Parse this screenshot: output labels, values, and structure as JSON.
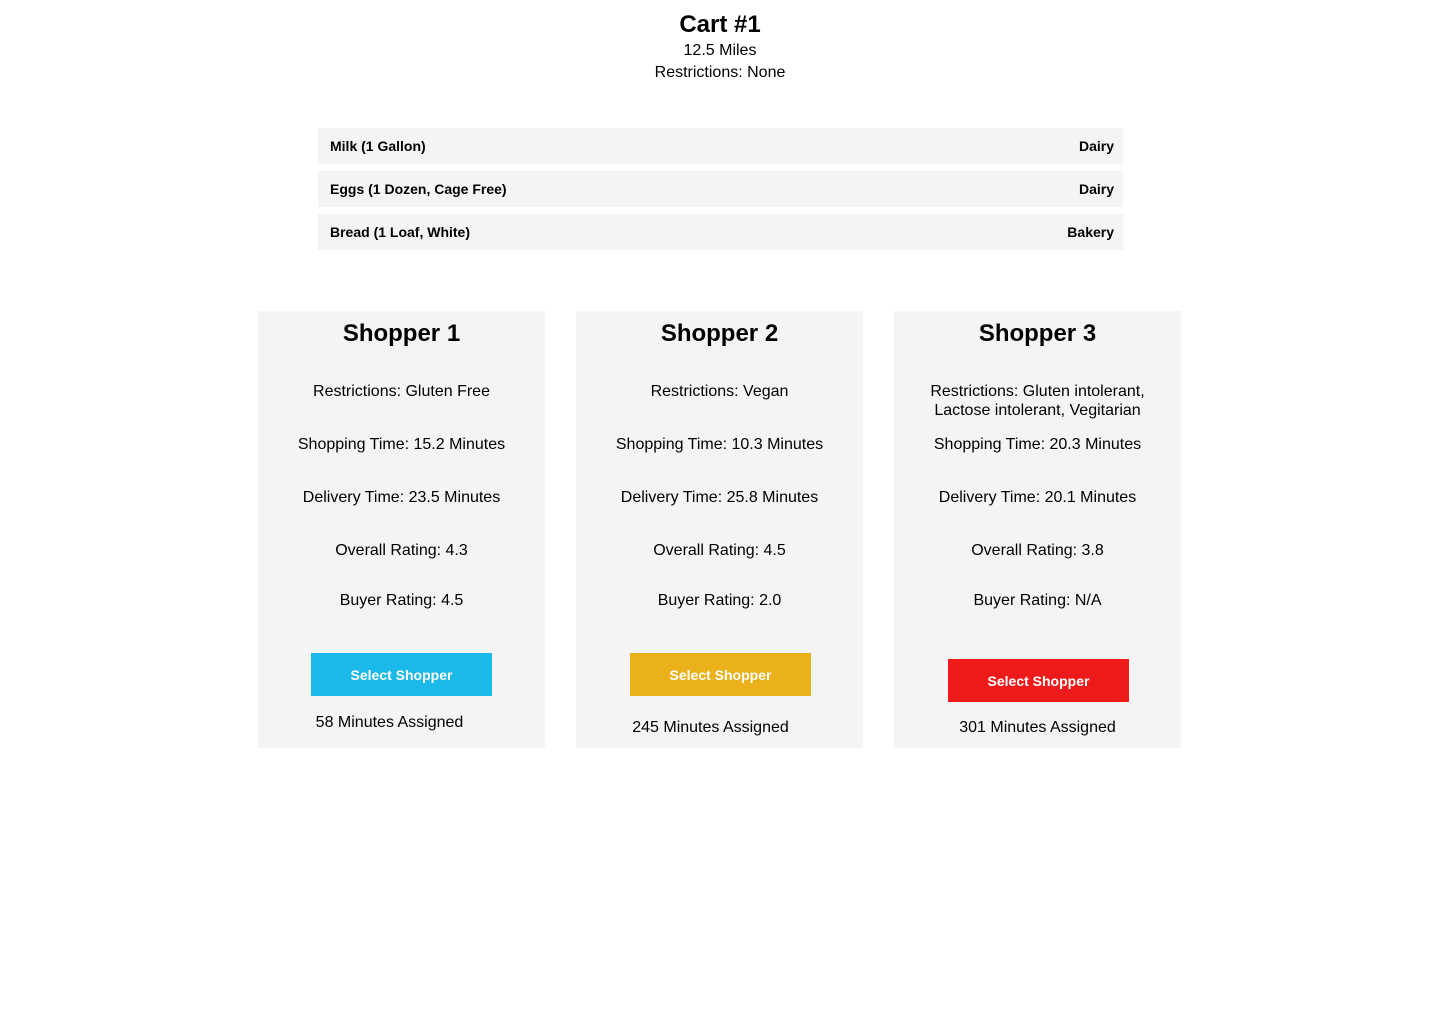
{
  "cart": {
    "title": "Cart #1",
    "distance": "12.5 Miles",
    "restrictions": "Restrictions: None"
  },
  "items": [
    {
      "name": "Milk (1 Gallon)",
      "category": "Dairy"
    },
    {
      "name": "Eggs (1 Dozen, Cage Free)",
      "category": "Dairy"
    },
    {
      "name": "Bread (1 Loaf, White)",
      "category": "Bakery"
    }
  ],
  "shoppers": [
    {
      "name": "Shopper 1",
      "restrictions": "Restrictions: Gluten Free",
      "shopping_time": "Shopping Time: 15.2 Minutes",
      "delivery_time": "Delivery Time: 23.5 Minutes",
      "overall_rating": "Overall Rating: 4.3",
      "buyer_rating": "Buyer Rating: 4.5",
      "button_label": "Select Shopper",
      "button_color": "#1bb8ea",
      "assigned": "58 Minutes Assigned"
    },
    {
      "name": "Shopper 2",
      "restrictions": "Restrictions: Vegan",
      "shopping_time": "Shopping Time: 10.3 Minutes",
      "delivery_time": "Delivery Time: 25.8 Minutes",
      "overall_rating": "Overall Rating: 4.5",
      "buyer_rating": "Buyer Rating: 2.0",
      "button_label": "Select Shopper",
      "button_color": "#eab11a",
      "assigned": "245 Minutes Assigned"
    },
    {
      "name": "Shopper 3",
      "restrictions": "Restrictions: Gluten intolerant, Lactose intolerant, Vegitarian",
      "shopping_time": "Shopping Time: 20.3 Minutes",
      "delivery_time": "Delivery Time: 20.1 Minutes",
      "overall_rating": "Overall Rating: 3.8",
      "buyer_rating": "Buyer Rating: N/A",
      "button_label": "Select Shopper",
      "button_color": "#ef1a1a",
      "assigned": "301 Minutes Assigned"
    }
  ]
}
